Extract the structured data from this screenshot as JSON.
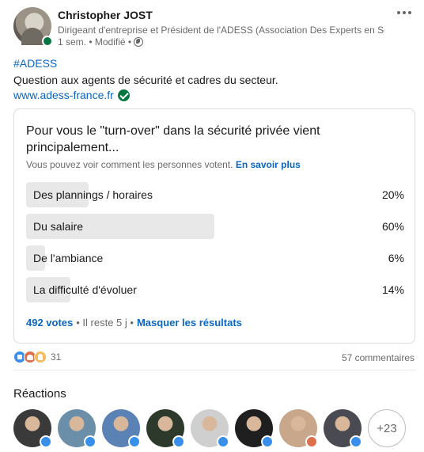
{
  "post": {
    "author": {
      "name": "Christopher JOST",
      "headline": "Dirigeant d'entreprise et Président de l'ADESS (Association Des Experts en Sé...",
      "meta": "1 sem. • Modifié •"
    },
    "hashtag": "#ADESS",
    "text": "Question aux agents de sécurité et cadres du secteur.",
    "link": "www.adess-france.fr"
  },
  "poll": {
    "question": "Pour vous le \"turn-over\" dans la sécurité privée vient principalement...",
    "note": "Vous pouvez voir comment les personnes votent.",
    "note_link": "En savoir plus",
    "options": [
      {
        "label": "Des plannings / horaires",
        "percent_text": "20%",
        "percent": 20
      },
      {
        "label": "Du salaire",
        "percent_text": "60%",
        "percent": 60
      },
      {
        "label": "De l'ambiance",
        "percent_text": "6%",
        "percent": 6
      },
      {
        "label": "La difficulté d'évoluer",
        "percent_text": "14%",
        "percent": 14
      }
    ],
    "votes": "492 votes",
    "time_left": "• Il reste 5 j •",
    "hide_results": "Masquer les résultats"
  },
  "social": {
    "reaction_icons": [
      "like-icon",
      "love-icon",
      "insight-icon"
    ],
    "reaction_count": "31",
    "comments": "57 commentaires"
  },
  "reactions": {
    "title": "Réactions",
    "reactors": [
      {
        "name": "reactor-1",
        "badge": "like",
        "color": "#3a3a3a"
      },
      {
        "name": "reactor-2",
        "badge": "like",
        "color": "#6b8fa8"
      },
      {
        "name": "reactor-3",
        "badge": "like",
        "color": "#5b82b5"
      },
      {
        "name": "reactor-4",
        "badge": "like",
        "color": "#2d3a2b"
      },
      {
        "name": "reactor-5",
        "badge": "like",
        "color": "#cfcfcf"
      },
      {
        "name": "reactor-6",
        "badge": "like",
        "color": "#1f1f1f"
      },
      {
        "name": "reactor-7",
        "badge": "love",
        "color": "#c9a78a"
      },
      {
        "name": "reactor-8",
        "badge": "like",
        "color": "#4a4a52"
      }
    ],
    "more": "+23"
  }
}
